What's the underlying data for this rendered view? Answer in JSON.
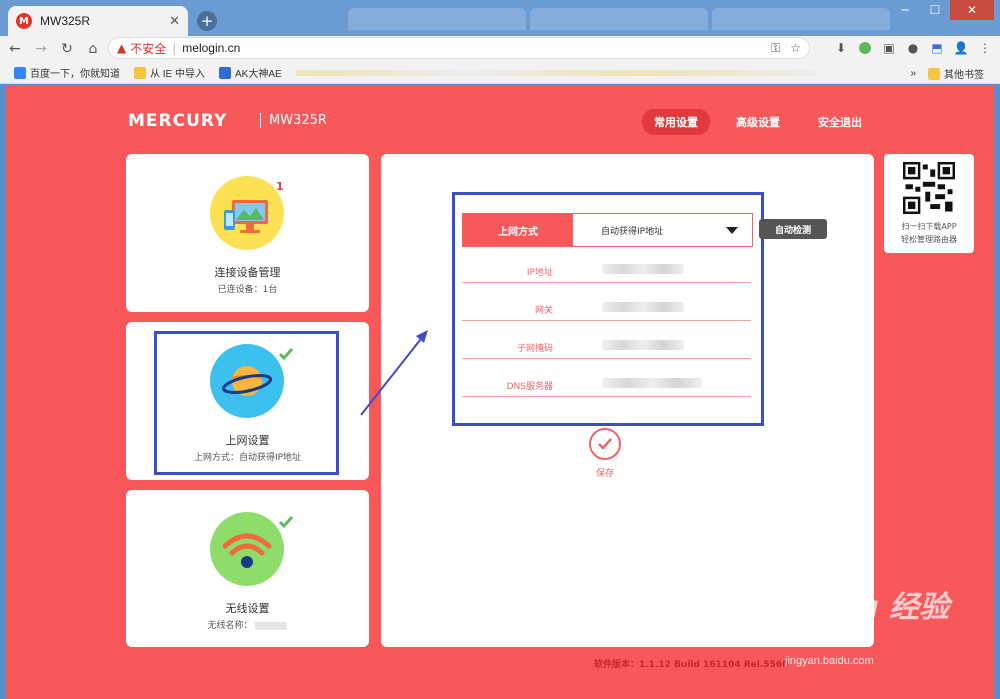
{
  "browser": {
    "tab_title": "MW325R",
    "tab_favicon": "M",
    "tab_close": "✕",
    "new_tab": "+",
    "url_warning": "不安全",
    "url": "melogin.cn",
    "bookmarks": [
      {
        "label": "百度一下，你就知道",
        "color": "#3385ff"
      },
      {
        "label": "从 IE 中导入",
        "color": "#f4c542"
      },
      {
        "label": "AK大神AE",
        "color": "#2d6bd6"
      }
    ],
    "bookmarks_more": "»",
    "bookmarks_other": "其他书签"
  },
  "header": {
    "logo": "MERCURY",
    "model": "MW325R",
    "nav": [
      {
        "label": "常用设置",
        "active": true
      },
      {
        "label": "高级设置",
        "active": false
      },
      {
        "label": "安全退出",
        "active": false
      }
    ]
  },
  "cards": {
    "devices": {
      "title": "连接设备管理",
      "sub": "已连设备：1台",
      "badge": "1"
    },
    "internet": {
      "title": "上网设置",
      "sub": "上网方式：自动获得IP地址"
    },
    "wireless": {
      "title": "无线设置",
      "sub": "无线名称："
    }
  },
  "form": {
    "mode_label": "上网方式",
    "mode_value": "自动获得IP地址",
    "detect_button": "自动检测",
    "fields": [
      {
        "label": "IP地址"
      },
      {
        "label": "网关"
      },
      {
        "label": "子网掩码"
      },
      {
        "label": "DNS服务器"
      }
    ],
    "save_label": "保存"
  },
  "qr": {
    "line1": "扫一扫下载APP",
    "line2": "轻松管理路由器"
  },
  "footer": {
    "version": "软件版本：1.1.12 Build 161104 Rel.5560"
  },
  "watermark": {
    "main": "Bai du 经验",
    "sub": "jingyan.baidu.com"
  },
  "colors": {
    "page_bg": "#f8585a",
    "accent": "#e23a3c",
    "annotation": "#3b4dc8"
  }
}
